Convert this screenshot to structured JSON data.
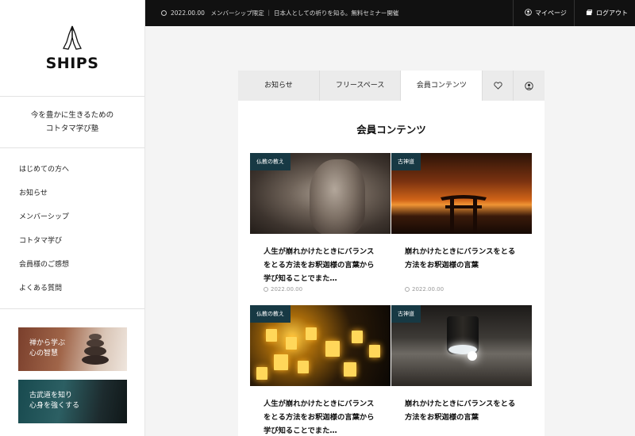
{
  "brand": {
    "name": "SHIPS"
  },
  "tagline": [
    "今を豊かに生きるための",
    "コトタマ学び塾"
  ],
  "nav": [
    "はじめての方へ",
    "お知らせ",
    "メンバーシップ",
    "コトタマ学び",
    "会員様のご感想",
    "よくある質問"
  ],
  "banners": [
    {
      "lines": [
        "禅から学ぶ",
        "心の智慧"
      ]
    },
    {
      "lines": [
        "古武道を知り",
        "心身を強くする"
      ]
    }
  ],
  "topbar": {
    "news": "2022.00.00　メンバーシップ限定 ｜ 日本人としての祈りを知る。無料セミナー開催",
    "mypage": "マイページ",
    "logout": "ログアウト"
  },
  "tabs": [
    "お知らせ",
    "フリースペース",
    "会員コンテンツ"
  ],
  "section_title": "会員コンテンツ",
  "cards": [
    {
      "tag": "仏教の教え",
      "title": "人生が崩れかけたときにバランスをとる方法をお釈迦様の言葉から学び知ることでまた…",
      "date": "2022.00.00"
    },
    {
      "tag": "古神道",
      "title": "崩れかけたときにバランスをとる方法をお釈迦様の言葉",
      "date": "2022.00.00"
    },
    {
      "tag": "仏教の教え",
      "title": "人生が崩れかけたときにバランスをとる方法をお釈迦様の言葉から学び知ることでまた…",
      "date": ""
    },
    {
      "tag": "古神道",
      "title": "崩れかけたときにバランスをとる方法をお釈迦様の言葉",
      "date": ""
    }
  ],
  "colors": {
    "topbar": "#111111",
    "tag_bg": "#173944",
    "panel": "#ffffff",
    "page_bg": "#f4f4f4"
  }
}
